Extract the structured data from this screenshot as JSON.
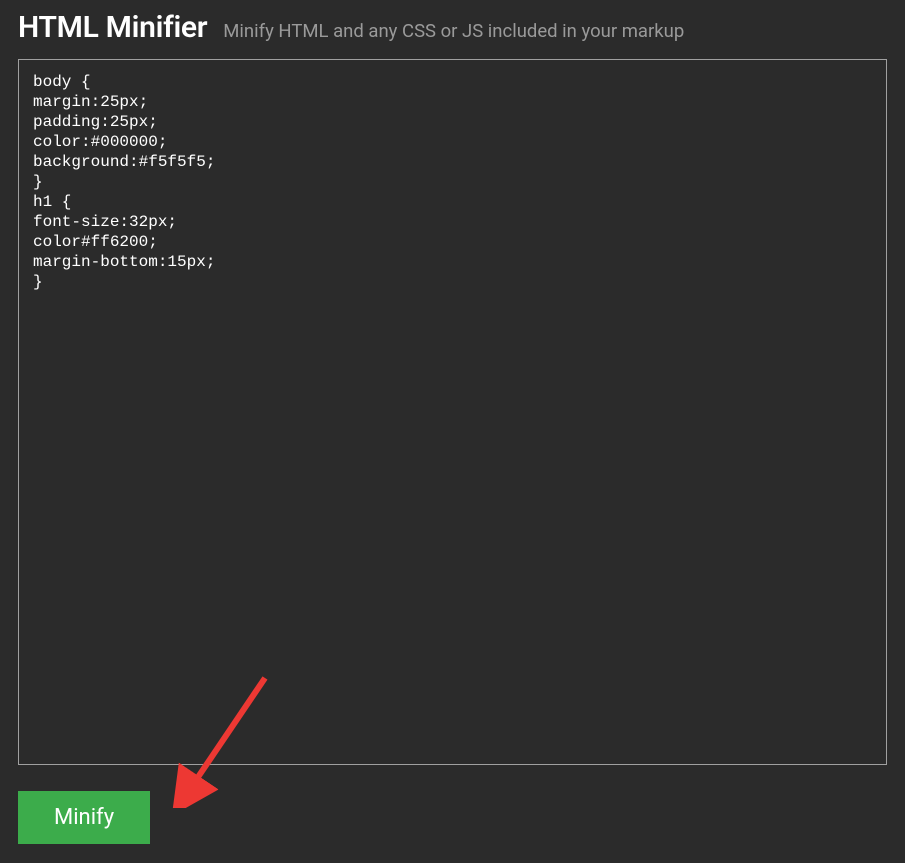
{
  "header": {
    "title": "HTML Minifier",
    "subtitle": "Minify HTML and any CSS or JS included in your markup"
  },
  "editor": {
    "content": "body {\nmargin:25px;\npadding:25px;\ncolor:#000000;\nbackground:#f5f5f5;\n}\nh1 {\nfont-size:32px;\ncolor#ff6200;\nmargin-bottom:15px;\n}"
  },
  "actions": {
    "minify_label": "Minify"
  },
  "annotation": {
    "arrow_color": "#ed3833"
  }
}
